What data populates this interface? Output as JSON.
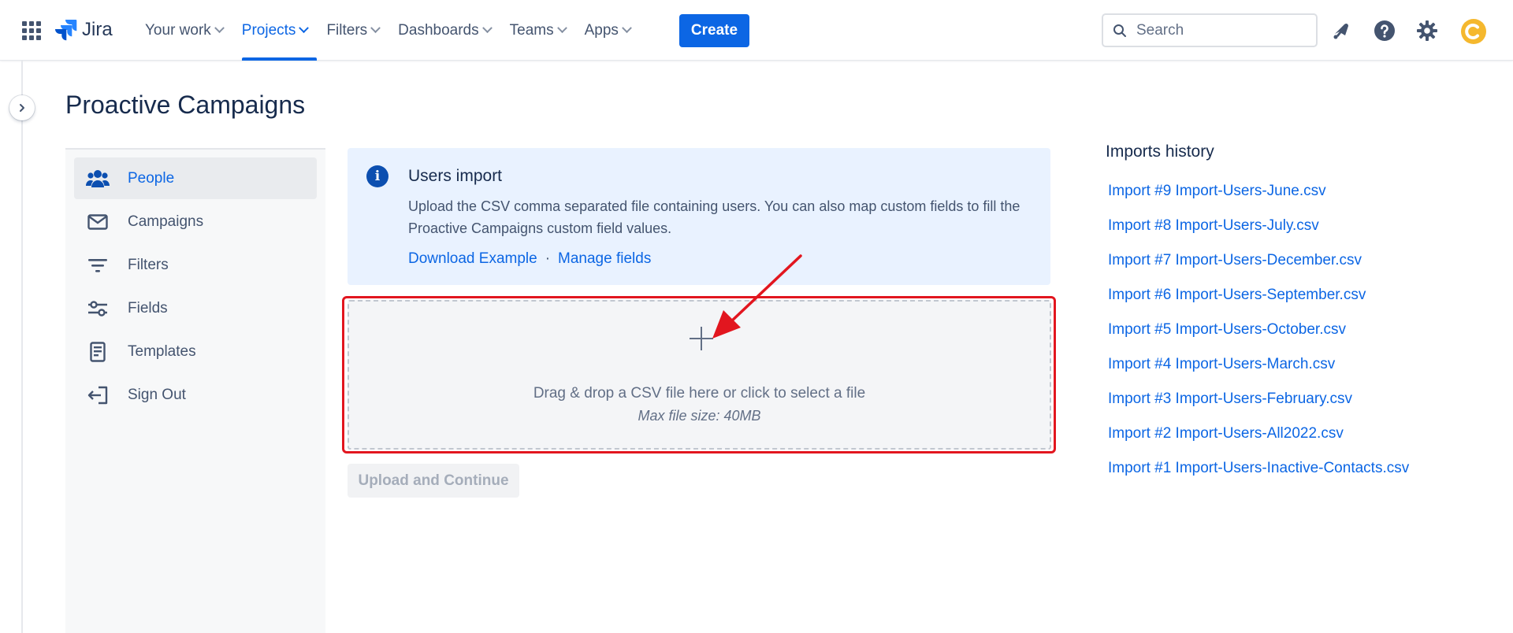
{
  "nav": {
    "logo_text": "Jira",
    "items": [
      {
        "label": "Your work",
        "active": false
      },
      {
        "label": "Projects",
        "active": true
      },
      {
        "label": "Filters",
        "active": false
      },
      {
        "label": "Dashboards",
        "active": false
      },
      {
        "label": "Teams",
        "active": false
      },
      {
        "label": "Apps",
        "active": false
      }
    ],
    "create_label": "Create",
    "search_placeholder": "Search",
    "icons": [
      "app-switcher-icon",
      "notifications-icon",
      "help-icon",
      "settings-icon",
      "avatar"
    ],
    "accent_color": "#0c66e4"
  },
  "page": {
    "title": "Proactive Campaigns"
  },
  "sidebar": {
    "items": [
      {
        "label": "People",
        "icon": "people-icon",
        "active": true
      },
      {
        "label": "Campaigns",
        "icon": "mail-icon",
        "active": false
      },
      {
        "label": "Filters",
        "icon": "filter-icon",
        "active": false
      },
      {
        "label": "Fields",
        "icon": "sliders-icon",
        "active": false
      },
      {
        "label": "Templates",
        "icon": "document-icon",
        "active": false
      },
      {
        "label": "Sign Out",
        "icon": "sign-out-icon",
        "active": false
      }
    ]
  },
  "info": {
    "title": "Users import",
    "text": "Upload the CSV comma separated file containing users. You can also map custom fields to fill the Proactive Campaigns custom field values.",
    "link_download": "Download Example",
    "separator": "·",
    "link_manage": "Manage fields"
  },
  "dropzone": {
    "text": "Drag & drop a CSV file here or click to select a file",
    "subtext": "Max file size: 40MB",
    "highlight_color": "#e2161f"
  },
  "upload_button": {
    "label": "Upload and Continue",
    "disabled": true
  },
  "history": {
    "title": "Imports history",
    "items": [
      "Import #9 Import-Users-June.csv",
      "Import #8 Import-Users-July.csv",
      "Import #7 Import-Users-December.csv",
      "Import #6 Import-Users-September.csv",
      "Import #5 Import-Users-October.csv",
      "Import #4 Import-Users-March.csv",
      "Import #3 Import-Users-February.csv",
      "Import #2 Import-Users-All2022.csv",
      "Import #1 Import-Users-Inactive-Contacts.csv"
    ]
  }
}
